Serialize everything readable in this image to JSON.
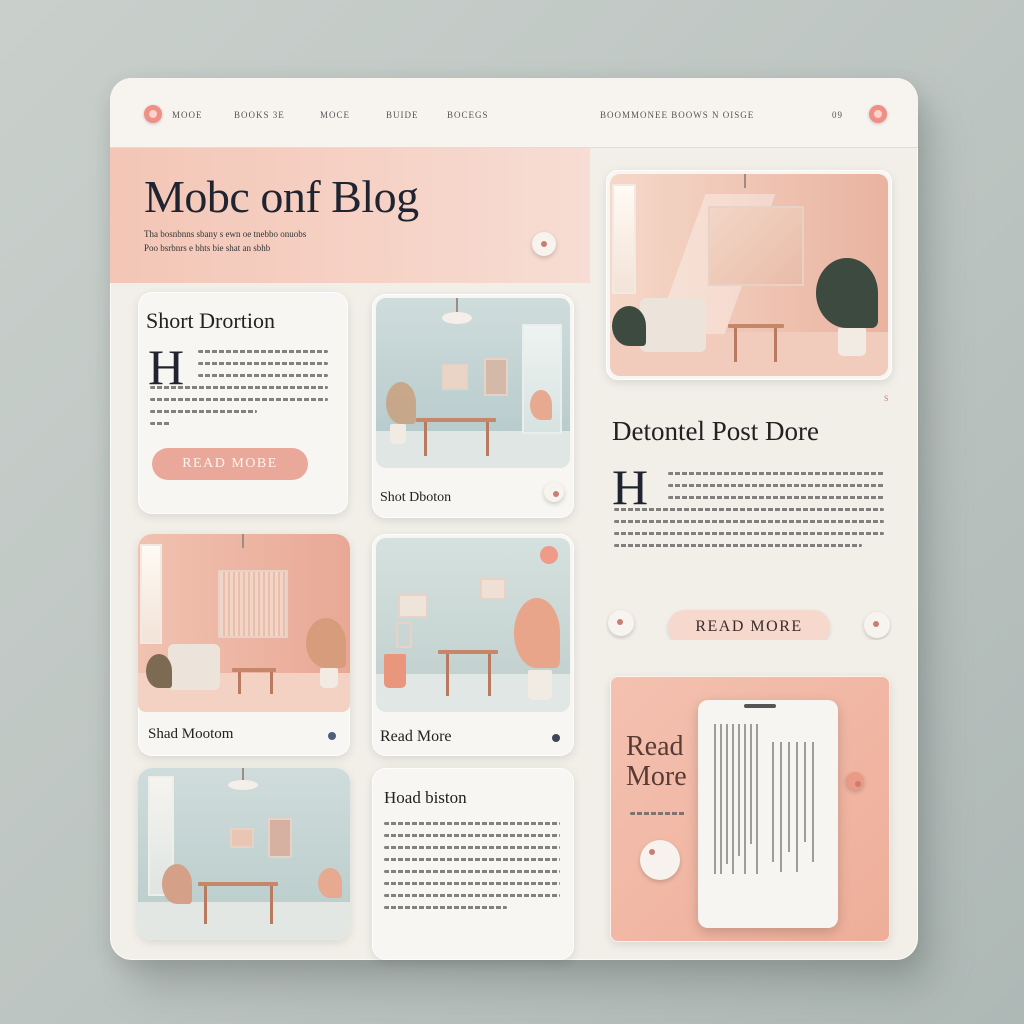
{
  "nav": {
    "items": [
      "MOOE",
      "BOOKS 3E",
      "MOCE",
      "BUIDE",
      "BOCEGS",
      "BOOMMONEE BOOWS",
      "N OISGE",
      "09"
    ]
  },
  "hero": {
    "title": "Mobc onf Blog",
    "subtitle_1": "Tha bosnbnns sbany s ewn oe tnebbo onuobs",
    "subtitle_2": "Poo bsrbnrs e bhts bie shat an sbhb"
  },
  "card_short": {
    "title": "Short Drortion",
    "dropcap": "H",
    "button_label": "READ MOBE"
  },
  "card_photo_1": {
    "caption": "Shot Dboton"
  },
  "card_featured": {
    "title": "Detontel Post Dore",
    "dropcap": "H",
    "button_label": "READ MORE",
    "label_top": "S"
  },
  "card_photo_2": {
    "caption": "Shad Mootom"
  },
  "card_photo_3": {
    "caption": "Read More"
  },
  "card_text": {
    "title": "Hoad biston"
  },
  "card_promo": {
    "title_line_1": "Read",
    "title_line_2": "More"
  },
  "colors": {
    "accent": "#f08f85",
    "hero_bg": "#f3c6b6",
    "board_bg": "#f2efe9",
    "pill_bg": "#f6d8cd",
    "promo_bg": "#f1b8a5"
  }
}
